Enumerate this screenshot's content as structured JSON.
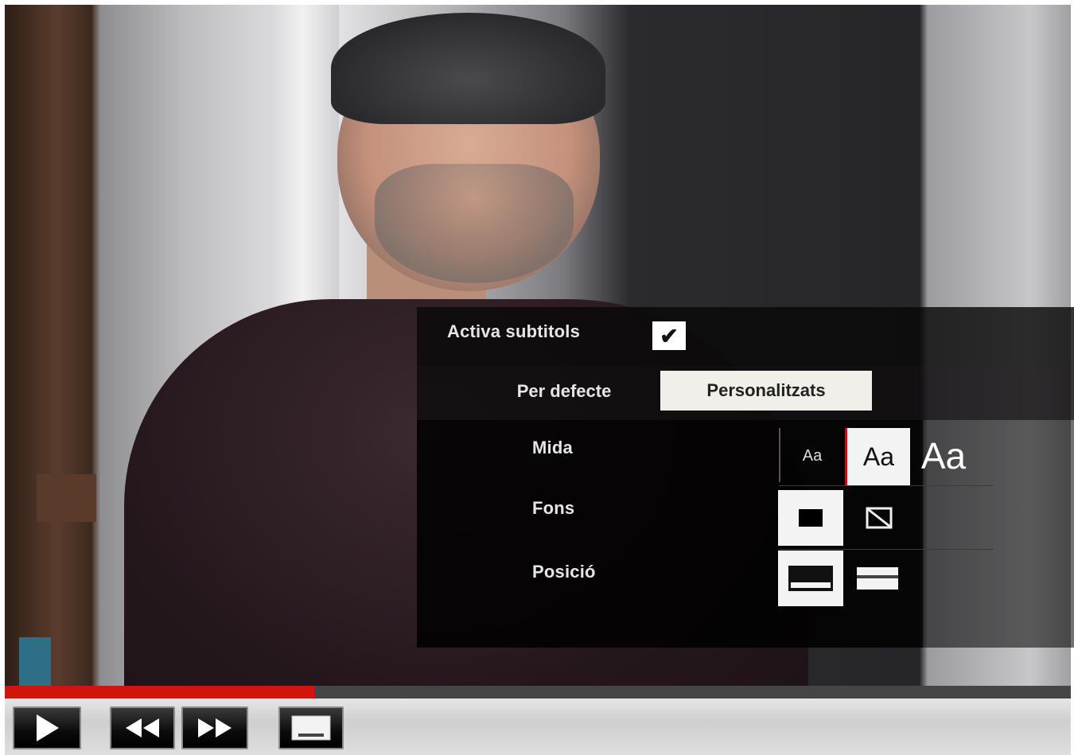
{
  "subtitles_panel": {
    "enable_label": "Activa subtitols",
    "enable_checked": true,
    "mode_tabs": [
      {
        "label": "Per defecte",
        "selected": false
      },
      {
        "label": "Personalitzats",
        "selected": true
      }
    ],
    "size_label": "Mida",
    "size_options": [
      {
        "label": "Aa",
        "size": "small",
        "selected": false
      },
      {
        "label": "Aa",
        "size": "medium",
        "selected": true
      },
      {
        "label": "Aa",
        "size": "large",
        "selected": false
      }
    ],
    "background_label": "Fons",
    "background_options": [
      {
        "icon": "background-filled-icon",
        "selected": true
      },
      {
        "icon": "background-none-icon",
        "selected": false
      }
    ],
    "position_label": "Posició",
    "position_options": [
      {
        "icon": "position-bottom-icon",
        "selected": true
      },
      {
        "icon": "position-top-icon",
        "selected": false
      }
    ]
  },
  "player": {
    "progress_fraction": 0.29,
    "progress_color": "#d3130e",
    "controls": [
      {
        "icon": "play-icon"
      },
      {
        "icon": "rewind-icon"
      },
      {
        "icon": "fast-forward-icon"
      },
      {
        "icon": "subtitles-icon"
      }
    ]
  }
}
